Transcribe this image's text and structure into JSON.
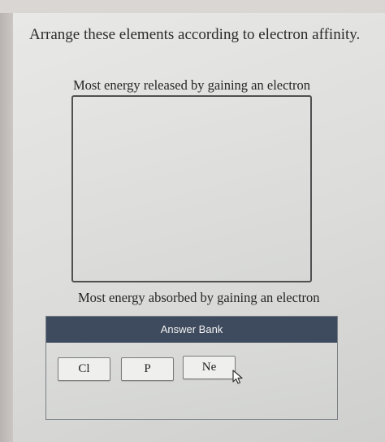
{
  "question": {
    "prompt": "Arrange these elements according to electron affinity."
  },
  "ranking": {
    "top_label": "Most energy released by gaining an electron",
    "bottom_label": "Most energy absorbed by gaining an electron",
    "items": []
  },
  "answer_bank": {
    "title": "Answer Bank",
    "items": [
      {
        "label": "Cl"
      },
      {
        "label": "P"
      },
      {
        "label": "Ne"
      }
    ]
  },
  "icons": {
    "cursor": "mouse-pointer-icon"
  },
  "colors": {
    "header_bg": "#3e4b5e",
    "panel_bg": "#e4e4e2"
  }
}
